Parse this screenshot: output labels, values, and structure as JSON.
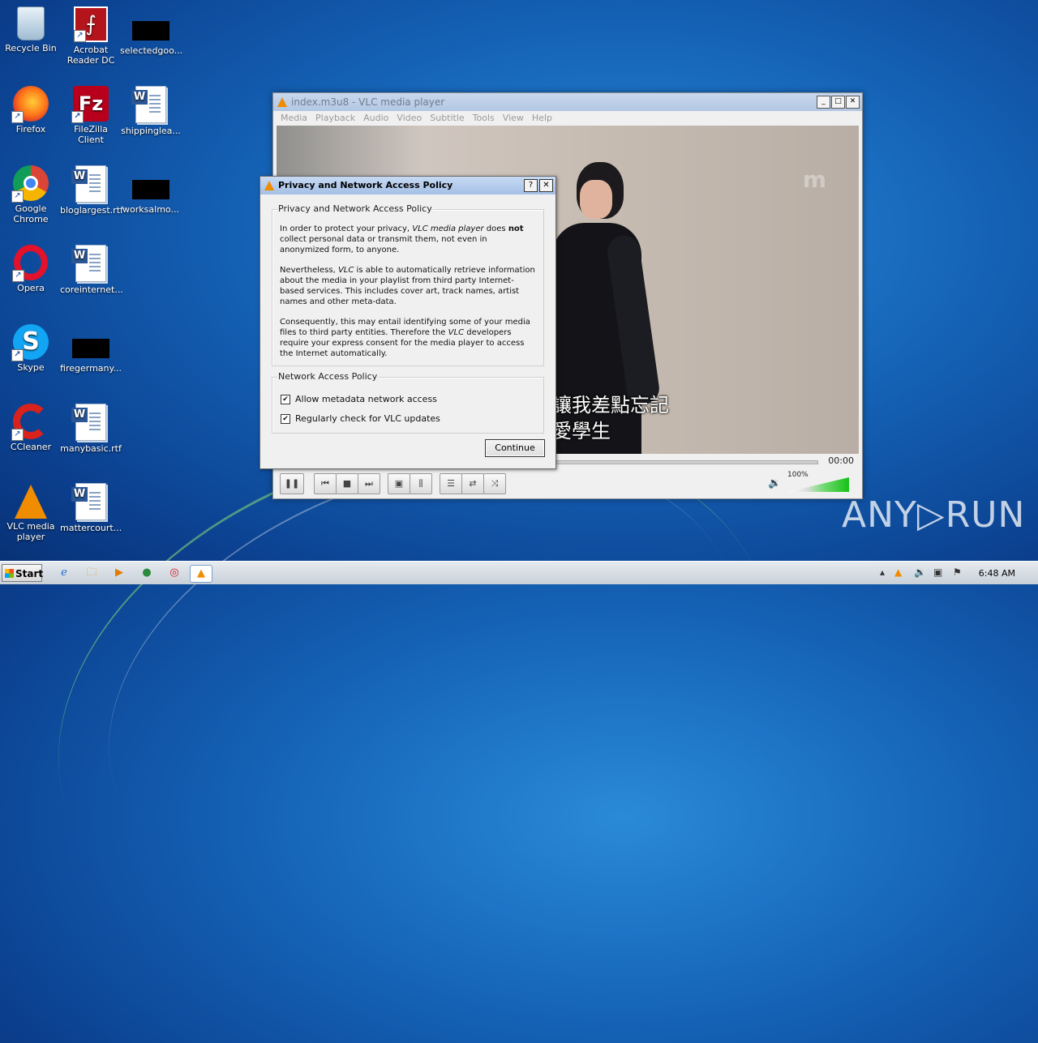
{
  "desktop": {
    "icons": [
      {
        "label": "Recycle Bin"
      },
      {
        "label": "Acrobat Reader DC"
      },
      {
        "label": "selectedgoo..."
      },
      {
        "label": "Firefox"
      },
      {
        "label": "FileZilla Client"
      },
      {
        "label": "shippinglea..."
      },
      {
        "label": "Google Chrome"
      },
      {
        "label": "bloglargest.rtf"
      },
      {
        "label": "worksalmo..."
      },
      {
        "label": "Opera"
      },
      {
        "label": "coreinternet..."
      },
      {
        "label": "Skype"
      },
      {
        "label": "firegermany..."
      },
      {
        "label": "CCleaner"
      },
      {
        "label": "manybasic.rtf"
      },
      {
        "label": "VLC media player"
      },
      {
        "label": "mattercourt..."
      }
    ]
  },
  "vlc": {
    "title": "index.m3u8 - VLC media player",
    "menu": [
      "Media",
      "Playback",
      "Audio",
      "Video",
      "Subtitle",
      "Tools",
      "View",
      "Help"
    ],
    "subtitle_line1": "讓我差點忘記",
    "subtitle_line2": "愛學生",
    "watermark": "m",
    "time": "00:00",
    "volume": "100%",
    "volume_level": 1.0
  },
  "dialog": {
    "title": "Privacy and Network Access Policy",
    "help_btn": "?",
    "close_btn": "✕",
    "group1_legend": "Privacy and Network Access Policy",
    "p1_a": "In order to protect your privacy, ",
    "p1_em": "VLC media player",
    "p1_b": " does ",
    "p1_strong": "not",
    "p1_c": " collect personal data or transmit them, not even in anonymized form, to anyone.",
    "p2_a": "Nevertheless, ",
    "p2_em": "VLC",
    "p2_b": " is able to automatically retrieve information about the media in your playlist from third party Internet-based services. This includes cover art, track names, artist names and other meta-data.",
    "p3_a": "Consequently, this may entail identifying some of your media files to third party entities. Therefore the ",
    "p3_em": "VLC",
    "p3_b": " developers require your express consent for the media player to access the Internet automatically.",
    "group2_legend": "Network Access Policy",
    "check1": "Allow metadata network access",
    "check2": "Regularly check for VLC updates",
    "check_mark": "✔",
    "continue": "Continue"
  },
  "taskbar": {
    "start": "Start",
    "clock": "6:48 AM"
  },
  "watermark_text": "ANY▷RUN"
}
